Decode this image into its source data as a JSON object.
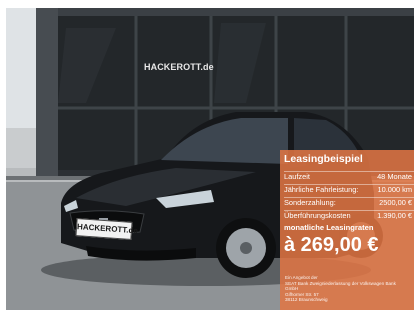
{
  "photo": {
    "dealer_sign": "HACKEROTT.de",
    "license_plate": "HACKEROTT.de"
  },
  "lease": {
    "title": "Leasingbeispiel",
    "rows": [
      {
        "label": "Laufzeit",
        "value": "48 Monate"
      },
      {
        "label": "Jährliche Fahrleistung:",
        "value": "10.000 km"
      },
      {
        "label": "Sonderzahlung:",
        "value": "2500,00 €"
      },
      {
        "label": "Überführungskosten",
        "value": "1.390,00 €"
      }
    ],
    "monthly_label": "monatliche Leasingraten",
    "price": "à 269,00 €",
    "footnote": [
      "Ein Angebot der",
      "SEAT Bank Zweigniederlassung der Volkswagen Bank",
      "GmbH",
      "Gifhorner Str. 57",
      "38112 Braunschweig"
    ]
  },
  "colors": {
    "panel": "#e27644",
    "car_body": "#16181b",
    "showroom_glass": "#23272a"
  }
}
